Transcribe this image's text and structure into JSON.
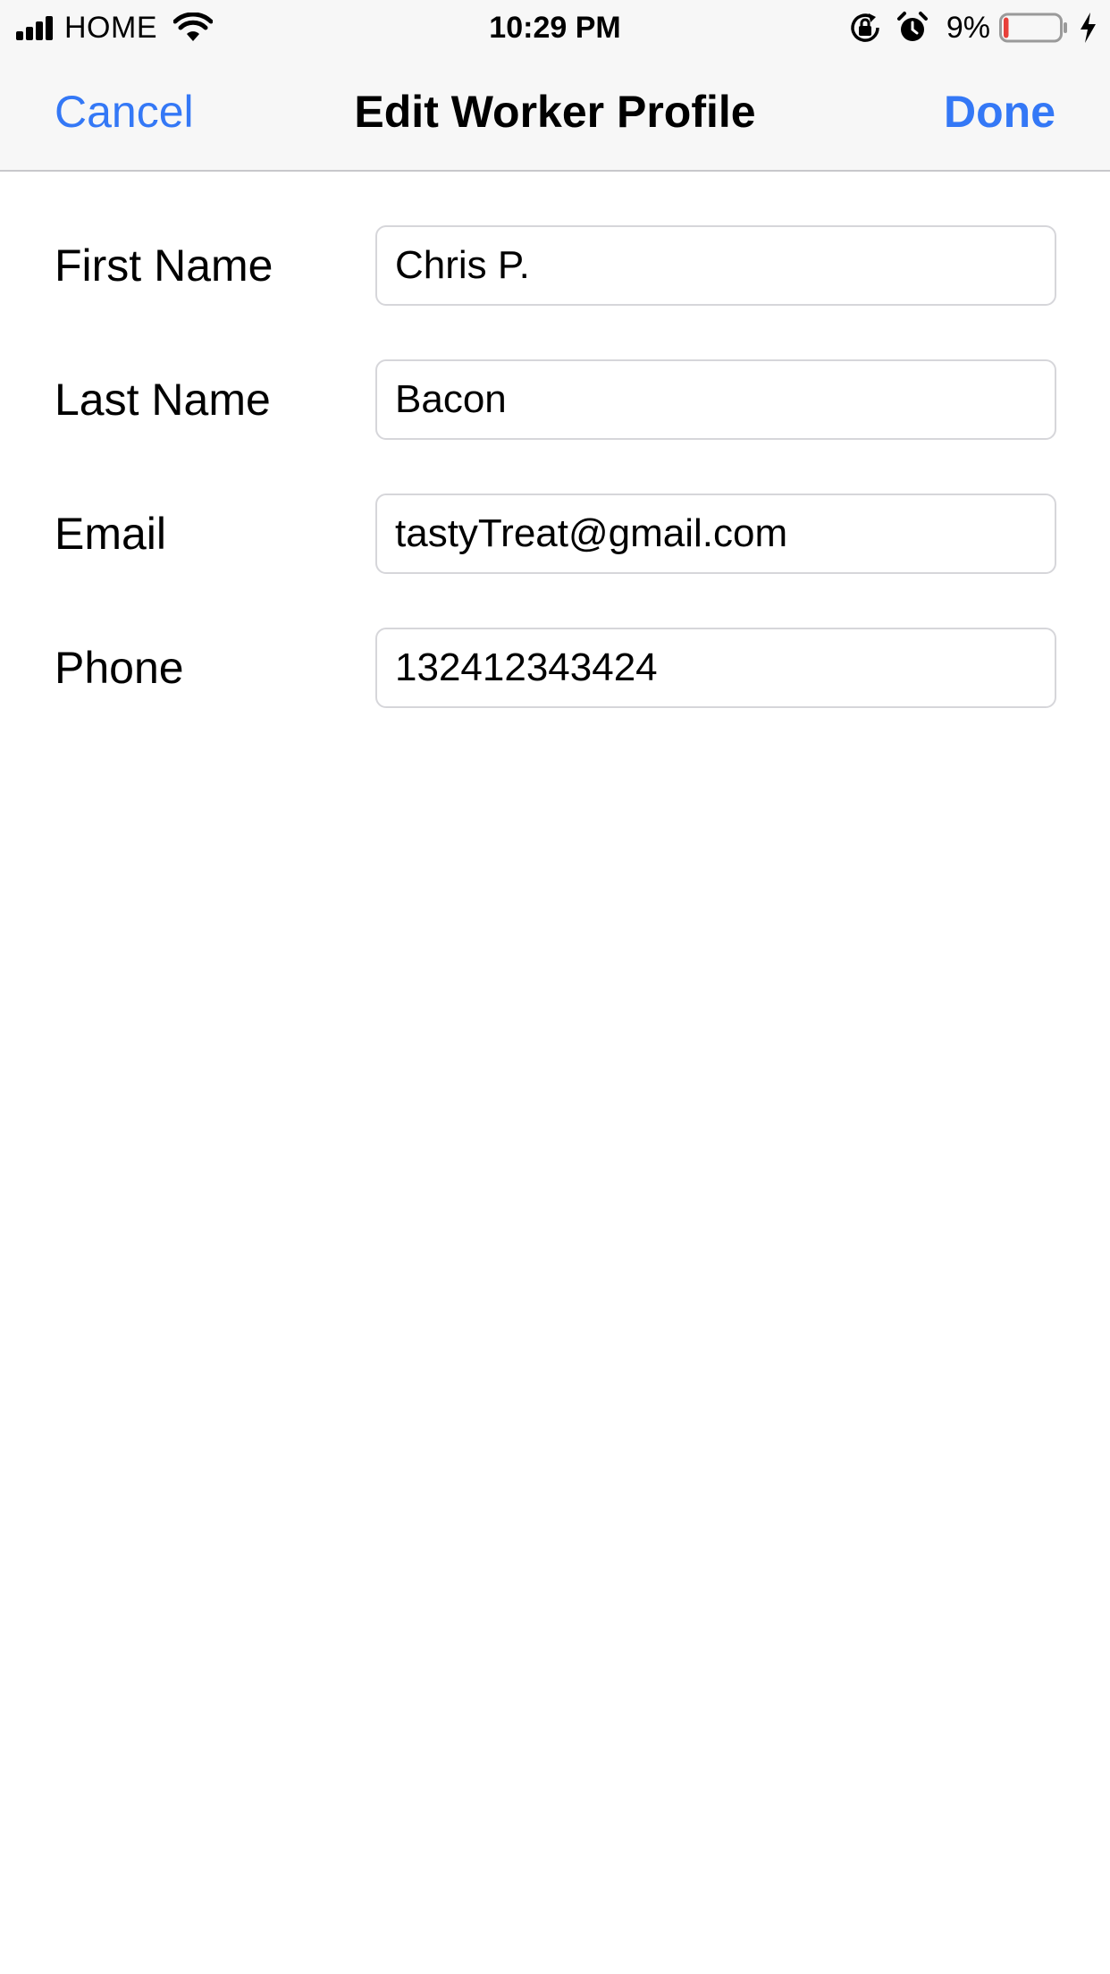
{
  "status_bar": {
    "carrier": "HOME",
    "time": "10:29 PM",
    "battery_percent": "9%",
    "battery_level": 0.09,
    "icons": [
      "signal-icon",
      "wifi-icon",
      "orientation-lock-icon",
      "alarm-icon",
      "battery-icon",
      "charging-icon"
    ]
  },
  "nav": {
    "cancel_label": "Cancel",
    "title": "Edit Worker Profile",
    "done_label": "Done"
  },
  "form": {
    "fields": [
      {
        "label": "First Name",
        "value": "Chris P."
      },
      {
        "label": "Last Name",
        "value": "Bacon"
      },
      {
        "label": "Email",
        "value": "tastyTreat@gmail.com"
      },
      {
        "label": "Phone",
        "value": "132412343424"
      }
    ]
  },
  "colors": {
    "accent": "#3478f6",
    "bar_background": "#f7f7f7",
    "battery_low": "#e8403a"
  }
}
